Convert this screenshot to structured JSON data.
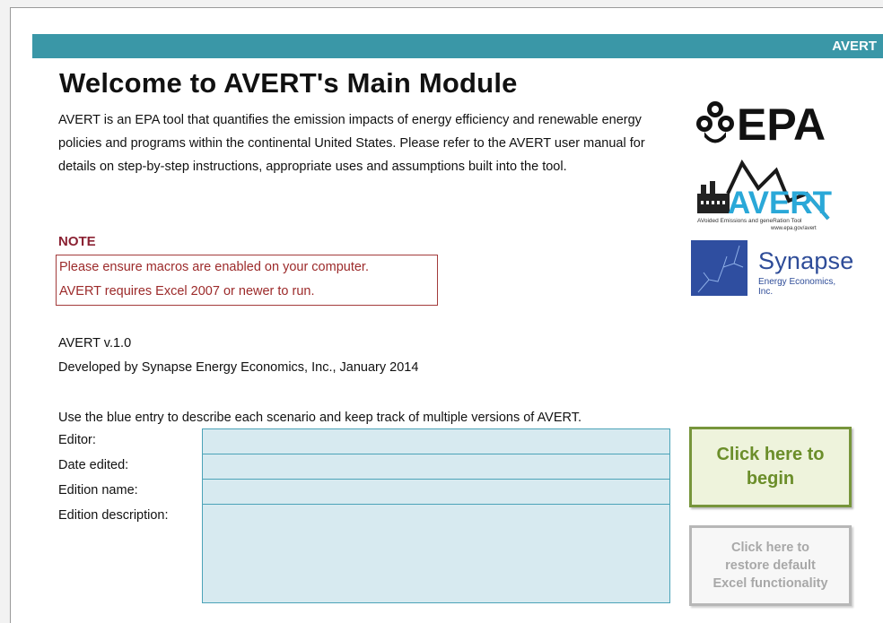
{
  "banner": {
    "label": "AVERT"
  },
  "title": "Welcome to AVERT's Main Module",
  "intro": "AVERT is an EPA tool that quantifies the emission impacts of energy efficiency and renewable energy policies and programs within the continental United States. Please refer to the AVERT user manual for details on step-by-step instructions, appropriate uses and assumptions built into the tool.",
  "note": {
    "heading": "NOTE",
    "lines": [
      "Please ensure macros are enabled on your computer.",
      "AVERT requires Excel 2007 or newer to run."
    ]
  },
  "version": "AVERT v.1.0",
  "developed_by": "Developed by Synapse Energy Economics, Inc., January 2014",
  "instruction": "Use the blue entry to describe each scenario and keep track of multiple versions of AVERT.",
  "fields": [
    {
      "label": "Editor:",
      "value": ""
    },
    {
      "label": "Date edited:",
      "value": ""
    },
    {
      "label": "Edition name:",
      "value": ""
    },
    {
      "label": "Edition description:",
      "value": ""
    }
  ],
  "buttons": {
    "begin_line1": "Click here to",
    "begin_line2": "begin",
    "restore_line1": "Click here to",
    "restore_line2": "restore default",
    "restore_line3": "Excel functionality"
  },
  "logos": {
    "epa": "EPA",
    "avert": "AVERT",
    "avert_tagline": "AVoided Emissions and geneRation Tool",
    "avert_url": "www.epa.gov/avert",
    "synapse_name": "Synapse",
    "synapse_sub": "Energy Economics, Inc."
  },
  "colors": {
    "banner": "#3a97a7",
    "note_red": "#9c2a2a",
    "entry_fill": "#d7eaf0",
    "begin_green": "#77953b",
    "restore_gray": "#b7b7b7",
    "synapse_blue": "#2f4ea0"
  }
}
